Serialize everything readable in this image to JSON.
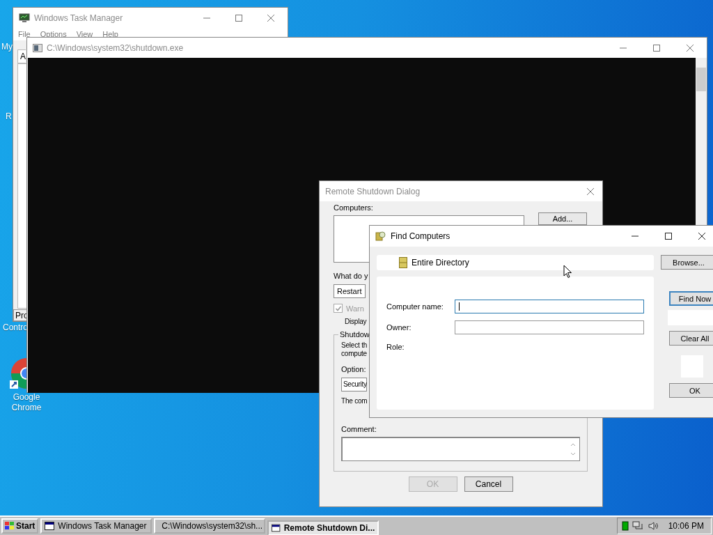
{
  "desktop_icons": [
    {
      "label": "My",
      "kind": "text"
    },
    {
      "label": "R",
      "kind": "text"
    },
    {
      "label": "Contro",
      "kind": "text"
    },
    {
      "label": "Google Chrome",
      "kind": "browser"
    }
  ],
  "task_manager": {
    "title": "Windows Task Manager",
    "menu": [
      "File",
      "Options",
      "View",
      "Help"
    ],
    "tab": "A",
    "button": "Pro"
  },
  "console": {
    "title": "C:\\Windows\\system32\\shutdown.exe"
  },
  "remote_dialog": {
    "title": "Remote Shutdown Dialog",
    "computers_label": "Computers:",
    "add_button": "Add...",
    "question": "What do y",
    "action": "Restart",
    "warn": {
      "label": "Warn",
      "checked": true,
      "disabled": true
    },
    "display": "Display",
    "group_title": "Shutdow",
    "group_text": [
      "Select th",
      "compute"
    ],
    "option_label": "Option:",
    "option": "Security",
    "status": "The com",
    "comment_label": "Comment:",
    "ok": {
      "label": "OK",
      "disabled": true
    },
    "cancel": {
      "label": "Cancel",
      "disabled": false
    }
  },
  "find_computers": {
    "title": "Find Computers",
    "location": "Entire Directory",
    "browse": "Browse...",
    "fields": [
      {
        "label": "Computer name:",
        "focused": true
      },
      {
        "label": "Owner:",
        "focused": false
      }
    ],
    "role_label": "Role:",
    "find_now": "Find Now",
    "clear_all": "Clear All",
    "ok": "OK"
  },
  "taskbar": {
    "start": "Start",
    "tasks": [
      {
        "label": "Windows Task Manager",
        "selected": false
      },
      {
        "label": "C:\\Windows\\system32\\sh...",
        "selected": false
      },
      {
        "label": "Remote Shutdown Di...",
        "selected": true
      }
    ],
    "clock": "10:06 PM"
  }
}
